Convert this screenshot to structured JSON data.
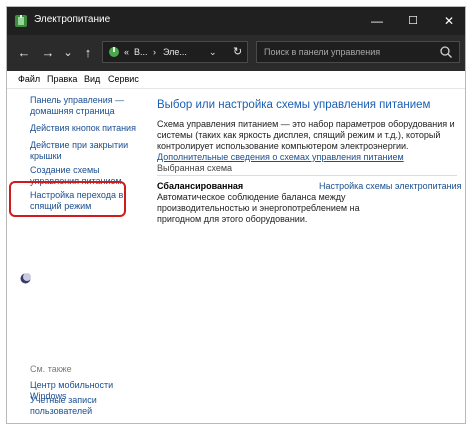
{
  "window": {
    "title": "Электропитание",
    "controls": {
      "minimize": "—",
      "maximize": "☐",
      "close": "✕"
    }
  },
  "nav": {
    "back": "←",
    "forward": "→",
    "dropdown": "⌄",
    "up": "↑",
    "address": {
      "seg1": "В...",
      "sep1": "›",
      "seg2": "Эле...",
      "chevron": "⌄",
      "refresh": "↻",
      "back_chevron": "«"
    },
    "search_placeholder": "Поиск в панели управления"
  },
  "menu": [
    "Файл",
    "Правка",
    "Вид",
    "Сервис"
  ],
  "sidebar": {
    "links": [
      "Панель управления — домашняя страница",
      "Действия кнопок питания",
      "Действие при закрытии крышки",
      "Создание схемы управления питанием",
      "Настройка перехода в спящий режим"
    ],
    "see_also_label": "См. также",
    "see_also": [
      "Центр мобильности Windows",
      "Учетные записи пользователей"
    ]
  },
  "main": {
    "heading": "Выбор или настройка схемы управления питанием",
    "description": "Схема управления питанием — это набор параметров оборудования и системы (таких как яркость дисплея, спящий режим и т.д.), который контролирует использование компьютером электроэнергии.",
    "description_link": "Дополнительные сведения о схемах управления питанием",
    "selected_label": "Выбранная схема",
    "plan_name": "Сбалансированная",
    "plan_settings_link": "Настройка схемы электропитания",
    "plan_description": "Автоматическое соблюдение баланса между производительностью и энергопотреблением на пригодном для этого оборудовании."
  },
  "colors": {
    "accent": "#1a5fb4",
    "link": "#1a4f91",
    "highlight": "#d11a1a",
    "titlebar": "#202020"
  }
}
